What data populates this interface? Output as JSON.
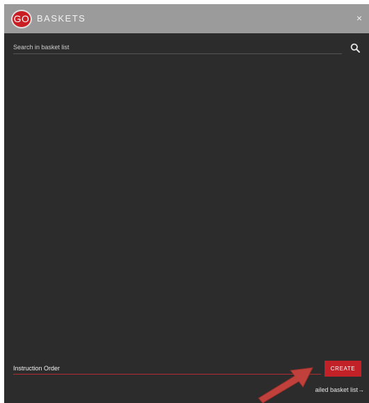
{
  "header": {
    "logo_text": "GO",
    "title": "BASKETS",
    "close_glyph": "×",
    "brand_color": "#c81e24"
  },
  "search": {
    "placeholder": "Search in basket list",
    "icon": "search-icon"
  },
  "new_basket": {
    "value": "Instruction Order",
    "create_label": "CREATE",
    "accent_color": "#c12127"
  },
  "footer": {
    "detail_link_label": "ailed basket list",
    "arrow_glyph": "→"
  },
  "annotation": {
    "icon": "arrow-pointer-icon",
    "color": "#c0413b"
  }
}
